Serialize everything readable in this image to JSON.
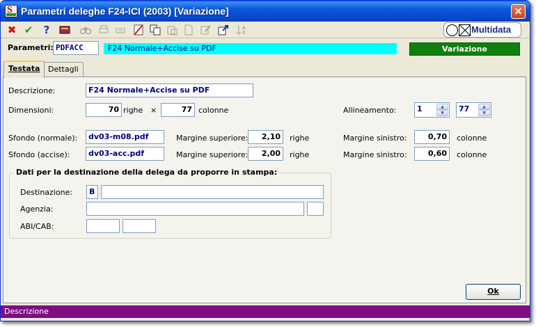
{
  "window": {
    "title": "Parametri deleghe F24-ICI (2003) [Variazione]",
    "close_glyph": "✕"
  },
  "toolbar": {
    "icons": [
      "cancel-icon",
      "confirm-icon",
      "help-icon",
      "book-icon",
      "binoculars-icon",
      "print-icon",
      "print-preview-icon",
      "delete-icon",
      "copy-icon",
      "paste-icon",
      "new-document-icon",
      "edit-icon",
      "export-icon",
      "sort-icon"
    ],
    "logo_text": "Multidata"
  },
  "params": {
    "label": "Parametri:",
    "code": "PDFACC",
    "description": "F24 Normale+Accise su PDF",
    "status": "Variazione"
  },
  "tabs": [
    {
      "label": "Testata"
    },
    {
      "label": "Dettagli"
    }
  ],
  "testata": {
    "descrizione_label": "Descrizione:",
    "descrizione_value": "F24 Normale+Accise su PDF",
    "dimensioni_label": "Dimensioni:",
    "righe_value": "70",
    "righe_unit": "righe",
    "times": "×",
    "colonne_value": "77",
    "colonne_unit": "colonne",
    "allineamento_label": "Allineamento:",
    "allineamento_1": "1",
    "allineamento_2": "77",
    "sfondo_normale_label": "Sfondo (normale):",
    "sfondo_normale_value": "dv03-m08.pdf",
    "sfondo_accise_label": "Sfondo (accise):",
    "sfondo_accise_value": "dv03-acc.pdf",
    "margine_sup_label": "Margine superiore:",
    "margine_sup_normale": "2,10",
    "margine_sup_accise": "2,00",
    "righe_label": "righe",
    "margine_sin_label": "Margine sinistro:",
    "margine_sin_normale": "0,70",
    "margine_sin_accise": "0,60",
    "colonne_label": "colonne"
  },
  "destinazione": {
    "title": "Dati per la destinazione della delega da proporre in stampa:",
    "destinazione_label": "Destinazione:",
    "destinazione_code": "B",
    "destinazione_value": "",
    "agenzia_label": "Agenzia:",
    "agenzia_value": "",
    "agenzia_extra": "",
    "abicab_label": "ABI/CAB:",
    "abi_value": "",
    "cab_value": ""
  },
  "ok_button": "Ok",
  "statusbar": "Descrizione"
}
